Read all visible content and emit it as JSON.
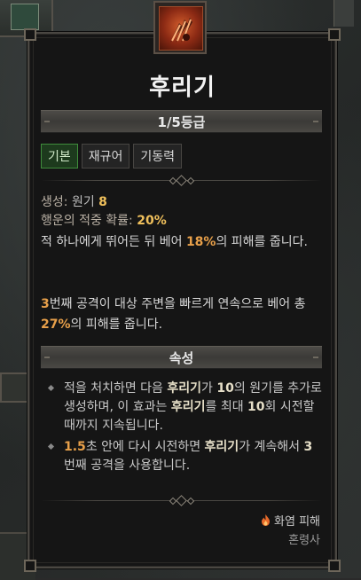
{
  "skill": {
    "name": "후리기",
    "rank": "1/5등급"
  },
  "tabs": [
    {
      "label": "기본",
      "active": true
    },
    {
      "label": "재규어",
      "active": false
    },
    {
      "label": "기동력",
      "active": false
    }
  ],
  "stats": {
    "generate_label": "생성:",
    "generate_resource": "원기",
    "generate_value": "8",
    "crit_label": "행운의 적중 확률:",
    "crit_value": "20%"
  },
  "description": {
    "p1_a": "적 하나에게 뛰어든 뒤 베어 ",
    "p1_val": "18%",
    "p1_b": "의 피해를 줍니다.",
    "p2_val1": "3",
    "p2_a": "번째 공격이 대상 주변을 빠르게 연속으로 베어 총 ",
    "p2_val2": "27%",
    "p2_b": "의 피해를 줍니다."
  },
  "properties_header": "속성",
  "properties": {
    "item1_a": "적을 처치하면 다음 ",
    "item1_skill": "후리기",
    "item1_b": "가 ",
    "item1_val": "10",
    "item1_c": "의 원기를 추가로 생성하며, 이 효과는 ",
    "item1_skill2": "후리기",
    "item1_d": "를 최대 ",
    "item1_val2": "10",
    "item1_e": "회 시전할 때까지 지속됩니다.",
    "item2_val": "1.5",
    "item2_a": "초 안에 다시 시전하면 ",
    "item2_skill": "후리기",
    "item2_b": "가 계속해서 ",
    "item2_val2": "3",
    "item2_c": "번째 공격을 사용합니다."
  },
  "footer": {
    "damage_type": "화염 피해",
    "category": "혼령사"
  },
  "colors": {
    "highlight_gold": "#f0c05c",
    "highlight_orange": "#e8a04a",
    "active_tab": "#1d3a1d"
  },
  "icons": {
    "skill": "claw-slash-icon",
    "damage": "fire-icon"
  }
}
